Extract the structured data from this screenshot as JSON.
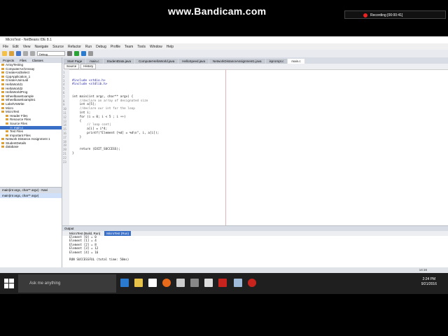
{
  "window": {
    "title": "MicroTest - NetBeans IDE 8.1"
  },
  "menu": [
    "File",
    "Edit",
    "View",
    "Navigate",
    "Source",
    "Refactor",
    "Run",
    "Debug",
    "Profile",
    "Team",
    "Tools",
    "Window",
    "Help"
  ],
  "toolbar": {
    "config": "Debug"
  },
  "projects_tabs": [
    "Projects",
    "Files",
    "Classes"
  ],
  "tree": [
    {
      "label": "ArrayTesting",
      "indent": 0
    },
    {
      "label": "ComputerArchAssay",
      "indent": 0
    },
    {
      "label": "CreateAndSelect",
      "indent": 0
    },
    {
      "label": "CppApplication_1",
      "indent": 0
    },
    {
      "label": "CreateAJoinLab",
      "indent": 0
    },
    {
      "label": "HelloWorld1",
      "indent": 0
    },
    {
      "label": "HelloWorld2",
      "indent": 0
    },
    {
      "label": "HelloWorldProg",
      "indent": 0
    },
    {
      "label": "WheelbaseExample",
      "indent": 0
    },
    {
      "label": "WheelbaseExample1",
      "indent": 0
    },
    {
      "label": "LabelVsWrite",
      "indent": 0
    },
    {
      "label": "Micro",
      "indent": 0
    },
    {
      "label": "MicroTest",
      "indent": 0
    },
    {
      "label": "Header Files",
      "indent": 1
    },
    {
      "label": "Resource Files",
      "indent": 1
    },
    {
      "label": "Source Files",
      "indent": 1
    },
    {
      "label": "main.c",
      "indent": 2,
      "selected": true
    },
    {
      "label": "Test Files",
      "indent": 1
    },
    {
      "label": "Important Files",
      "indent": 1
    },
    {
      "label": "Network Distance Assignment 1",
      "indent": 0
    },
    {
      "label": "StudentDetails",
      "indent": 0
    },
    {
      "label": "database",
      "indent": 0
    }
  ],
  "navigator": {
    "header": "main(int argc, char** argv) - Navi",
    "item": "main(int argc, char** argv)"
  },
  "editor_tabs": [
    {
      "label": "Start Page",
      "active": false
    },
    {
      "label": "main.c",
      "active": false
    },
    {
      "label": "StudentData.java",
      "active": false
    },
    {
      "label": "ComputerHelloWorld.java",
      "active": false
    },
    {
      "label": "HelloSpeed.java",
      "active": false
    },
    {
      "label": "NetworkDistanceAssignment1.java",
      "active": false
    },
    {
      "label": "isprompt.c",
      "active": false
    },
    {
      "label": "main.c",
      "active": true
    }
  ],
  "editor_toolbar": {
    "source": "Source",
    "history": "History"
  },
  "code_lines": [
    {
      "n": "1",
      "text": "",
      "type": "normal"
    },
    {
      "n": "2",
      "text": "",
      "type": "normal"
    },
    {
      "n": "3",
      "text": "#include <stdio.h>",
      "type": "kw"
    },
    {
      "n": "4",
      "text": "#include <stdlib.h>",
      "type": "kw"
    },
    {
      "n": "5",
      "text": "",
      "type": "normal"
    },
    {
      "n": "6",
      "text": "",
      "type": "normal"
    },
    {
      "n": "7",
      "text": "int main(int argc, char** argv) {",
      "type": "normal"
    },
    {
      "n": "8",
      "text": "    //declare an array of designated size",
      "type": "cm"
    },
    {
      "n": "9",
      "text": "    int a[5];",
      "type": "normal"
    },
    {
      "n": "10",
      "text": "    //declare our int for the loop",
      "type": "cm"
    },
    {
      "n": "11",
      "text": "    int i;",
      "type": "normal"
    },
    {
      "n": "12",
      "text": "    for (i = 0; i < 5 ; i ++)",
      "type": "normal"
    },
    {
      "n": "13",
      "text": "    {",
      "type": "normal"
    },
    {
      "n": "14",
      "text": "        // loop cont|",
      "type": "cm"
    },
    {
      "n": "15",
      "text": "        a[i] = i*4;",
      "type": "normal"
    },
    {
      "n": "16",
      "text": "        printf(\"Element [%d] = %d\\n\", i, a[i]);",
      "type": "normal"
    },
    {
      "n": "17",
      "text": "    }",
      "type": "normal"
    },
    {
      "n": "18",
      "text": "",
      "type": "normal"
    },
    {
      "n": "19",
      "text": "",
      "type": "normal"
    },
    {
      "n": "20",
      "text": "    return (EXIT_SUCCESS);",
      "type": "normal"
    },
    {
      "n": "21",
      "text": "}",
      "type": "normal"
    },
    {
      "n": "22",
      "text": "",
      "type": "normal"
    },
    {
      "n": "23",
      "text": "",
      "type": "normal"
    }
  ],
  "output": {
    "header": "Output",
    "tabs": [
      "MicroTest (Build, Run)",
      "MicroTest (Run)"
    ],
    "lines": [
      "Element [0] = 0",
      "Element [1] = 4",
      "Element [2] = 8",
      "Element [3] = 12",
      "Element [4] = 16",
      "",
      "RUN SUCCESSFUL (total time: 50ms)"
    ]
  },
  "status": {
    "position": "14:16"
  },
  "overlay": {
    "watermark": "www.Bandicam.com",
    "recording": "Recording [00:00:41]"
  },
  "taskbar": {
    "search_placeholder": "Ask me anything",
    "time": "2:24 PM",
    "date": "9/21/2016"
  }
}
